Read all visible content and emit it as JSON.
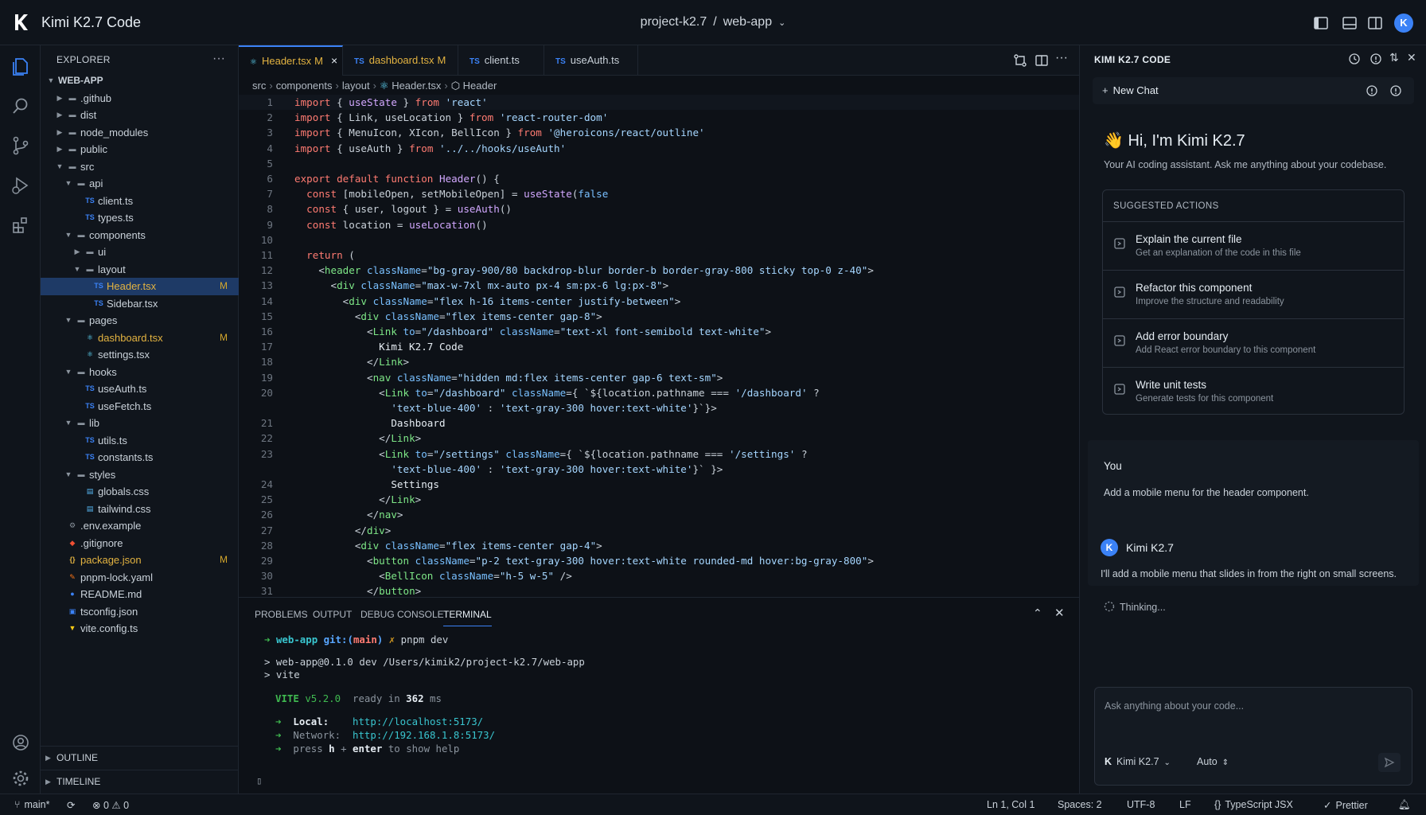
{
  "titlebar": {
    "app_title": "Kimi K2.7 Code",
    "project": "project-k2.7",
    "separator": "/",
    "folder": "web-app",
    "avatar_letter": "K"
  },
  "explorer": {
    "title": "EXPLORER",
    "more": "···",
    "tree": [
      {
        "label": "WEB-APP",
        "depth": 0,
        "type": "root"
      },
      {
        "label": ".github",
        "depth": 1,
        "type": "folder-closed"
      },
      {
        "label": "dist",
        "depth": 1,
        "type": "folder-closed"
      },
      {
        "label": "node_modules",
        "depth": 1,
        "type": "folder-closed"
      },
      {
        "label": "public",
        "depth": 1,
        "type": "folder-closed"
      },
      {
        "label": "src",
        "depth": 1,
        "type": "folder-open"
      },
      {
        "label": "api",
        "depth": 2,
        "type": "folder-open"
      },
      {
        "label": "client.ts",
        "depth": 3,
        "type": "ts"
      },
      {
        "label": "types.ts",
        "depth": 3,
        "type": "ts"
      },
      {
        "label": "components",
        "depth": 2,
        "type": "folder-open"
      },
      {
        "label": "ui",
        "depth": 3,
        "type": "folder-closed"
      },
      {
        "label": "layout",
        "depth": 3,
        "type": "folder-open"
      },
      {
        "label": "Header.tsx",
        "depth": 4,
        "type": "ts",
        "active": true,
        "badge": "M"
      },
      {
        "label": "Sidebar.tsx",
        "depth": 4,
        "type": "ts"
      },
      {
        "label": "pages",
        "depth": 2,
        "type": "folder-open"
      },
      {
        "label": "dashboard.tsx",
        "depth": 3,
        "type": "react",
        "badge": "M"
      },
      {
        "label": "settings.tsx",
        "depth": 3,
        "type": "react"
      },
      {
        "label": "hooks",
        "depth": 2,
        "type": "folder-open"
      },
      {
        "label": "useAuth.ts",
        "depth": 3,
        "type": "ts"
      },
      {
        "label": "useFetch.ts",
        "depth": 3,
        "type": "ts"
      },
      {
        "label": "lib",
        "depth": 2,
        "type": "folder-open"
      },
      {
        "label": "utils.ts",
        "depth": 3,
        "type": "ts"
      },
      {
        "label": "constants.ts",
        "depth": 3,
        "type": "ts"
      },
      {
        "label": "styles",
        "depth": 2,
        "type": "folder-open"
      },
      {
        "label": "globals.css",
        "depth": 3,
        "type": "css"
      },
      {
        "label": "tailwind.css",
        "depth": 3,
        "type": "css"
      },
      {
        "label": ".env.example",
        "depth": 1,
        "type": "env"
      },
      {
        "label": ".gitignore",
        "depth": 1,
        "type": "git"
      },
      {
        "label": "package.json",
        "depth": 1,
        "type": "json",
        "badge": "M"
      },
      {
        "label": "pnpm-lock.yaml",
        "depth": 1,
        "type": "yaml"
      },
      {
        "label": "README.md",
        "depth": 1,
        "type": "info"
      },
      {
        "label": "tsconfig.json",
        "depth": 1,
        "type": "ts-config"
      },
      {
        "label": "vite.config.ts",
        "depth": 1,
        "type": "vite"
      }
    ],
    "outline": "OUTLINE",
    "timeline": "TIMELINE"
  },
  "tabs": [
    {
      "label": "Header.tsx",
      "badge": "M",
      "active": true,
      "close": "×"
    },
    {
      "label": "dashboard.tsx",
      "badge": "M"
    },
    {
      "label": "client.ts"
    },
    {
      "label": "useAuth.ts"
    }
  ],
  "tab_type_label": "TS",
  "breadcrumb": [
    "src",
    "components",
    "layout",
    "Header.tsx",
    "Header"
  ],
  "code": [
    {
      "n": "1",
      "t": [
        [
          "kw",
          "import "
        ],
        [
          "",
          "{ "
        ],
        [
          "fn",
          "useState"
        ],
        [
          "",
          " } "
        ],
        [
          "kw",
          "from "
        ],
        [
          "str",
          "'react'"
        ]
      ]
    },
    {
      "n": "2",
      "t": [
        [
          "kw",
          "import "
        ],
        [
          "",
          "{ Link, useLocation } "
        ],
        [
          "kw",
          "from "
        ],
        [
          "str",
          "'react-router-dom'"
        ]
      ]
    },
    {
      "n": "3",
      "t": [
        [
          "kw",
          "import "
        ],
        [
          "",
          "{ MenuIcon, XIcon, BellIcon } "
        ],
        [
          "kw",
          "from "
        ],
        [
          "str",
          "'@heroicons/react/outline'"
        ]
      ]
    },
    {
      "n": "4",
      "t": [
        [
          "kw",
          "import "
        ],
        [
          "",
          "{ useAuth } "
        ],
        [
          "kw",
          "from "
        ],
        [
          "str",
          "'../../hooks/useAuth'"
        ]
      ]
    },
    {
      "n": "5",
      "t": []
    },
    {
      "n": "6",
      "t": [
        [
          "kw",
          "export default function "
        ],
        [
          "fn",
          "Header"
        ],
        [
          "",
          "() {"
        ]
      ]
    },
    {
      "n": "7",
      "t": [
        [
          "",
          "  "
        ],
        [
          "kw",
          "const "
        ],
        [
          "",
          "[mobileOpen, setMobileOpen] = "
        ],
        [
          "fn",
          "useState"
        ],
        [
          "",
          "("
        ],
        [
          "lit",
          "false"
        ],
        [
          ")"
        ]
      ]
    },
    {
      "n": "8",
      "t": [
        [
          "",
          "  "
        ],
        [
          "kw",
          "const "
        ],
        [
          "",
          "{ user, logout } = "
        ],
        [
          "fn",
          "useAuth"
        ],
        [
          "",
          "()"
        ]
      ]
    },
    {
      "n": "9",
      "t": [
        [
          "",
          "  "
        ],
        [
          "kw",
          "const "
        ],
        [
          "",
          "location = "
        ],
        [
          "fn",
          "useLocation"
        ],
        [
          "",
          "()"
        ]
      ]
    },
    {
      "n": "10",
      "t": []
    },
    {
      "n": "11",
      "t": [
        [
          "",
          "  "
        ],
        [
          "kw",
          "return "
        ],
        [
          "",
          "("
        ]
      ]
    },
    {
      "n": "12",
      "t": [
        [
          "",
          "    <"
        ],
        [
          "tag",
          "header "
        ],
        [
          "attr",
          "className"
        ],
        [
          "",
          "="
        ],
        [
          "str",
          "\"bg-gray-900/80 backdrop-blur border-b border-gray-800 sticky top-0 z-40\""
        ],
        [
          "",
          ">"
        ]
      ]
    },
    {
      "n": "13",
      "t": [
        [
          "",
          "      <"
        ],
        [
          "tag",
          "div "
        ],
        [
          "attr",
          "className"
        ],
        [
          "",
          "="
        ],
        [
          "str",
          "\"max-w-7xl mx-auto px-4 sm:px-6 lg:px-8\""
        ],
        [
          "",
          ">"
        ]
      ]
    },
    {
      "n": "14",
      "t": [
        [
          "",
          "        <"
        ],
        [
          "tag",
          "div "
        ],
        [
          "attr",
          "className"
        ],
        [
          "",
          "="
        ],
        [
          "str",
          "\"flex h-16 items-center justify-between\""
        ],
        [
          "",
          ">"
        ]
      ]
    },
    {
      "n": "15",
      "t": [
        [
          "",
          "          <"
        ],
        [
          "tag",
          "div "
        ],
        [
          "attr",
          "className"
        ],
        [
          "",
          "="
        ],
        [
          "str",
          "\"flex items-center gap-8\""
        ],
        [
          "",
          ">"
        ]
      ]
    },
    {
      "n": "16",
      "t": [
        [
          "",
          "            <"
        ],
        [
          "tag",
          "Link "
        ],
        [
          "attr",
          "to"
        ],
        [
          "",
          "="
        ],
        [
          "str",
          "\"/dashboard\" "
        ],
        [
          "attr",
          "className"
        ],
        [
          "",
          "="
        ],
        [
          "str",
          "\"text-xl font-semibold text-white\""
        ],
        [
          "",
          ">"
        ]
      ]
    },
    {
      "n": "17",
      "t": [
        [
          "jsx",
          "              Kimi K2.7 Code"
        ]
      ]
    },
    {
      "n": "18",
      "t": [
        [
          "",
          "            </"
        ],
        [
          "tag",
          "Link"
        ],
        [
          "",
          ">"
        ]
      ]
    },
    {
      "n": "19",
      "t": [
        [
          "",
          "            <"
        ],
        [
          "tag",
          "nav "
        ],
        [
          "attr",
          "className"
        ],
        [
          "",
          "="
        ],
        [
          "str",
          "\"hidden md:flex items-center gap-6 text-sm\""
        ],
        [
          "",
          ">"
        ]
      ]
    },
    {
      "n": "20",
      "t": [
        [
          "",
          "              <"
        ],
        [
          "tag",
          "Link "
        ],
        [
          "attr",
          "to"
        ],
        [
          "",
          "="
        ],
        [
          "str",
          "\"/dashboard\" "
        ],
        [
          "attr",
          "className"
        ],
        [
          "",
          "={ `${location.pathname === "
        ],
        [
          "str",
          "'/dashboard'"
        ],
        [
          "",
          " ?"
        ]
      ]
    },
    {
      "n": "",
      "t": [
        [
          "",
          "                "
        ],
        [
          "str",
          "'text-blue-400'"
        ],
        [
          "",
          " : "
        ],
        [
          "str",
          "'text-gray-300 hover:text-white'"
        ],
        [
          "",
          "}`}>"
        ]
      ]
    },
    {
      "n": "21",
      "t": [
        [
          "jsx",
          "                Dashboard"
        ]
      ]
    },
    {
      "n": "22",
      "t": [
        [
          "",
          "              </"
        ],
        [
          "tag",
          "Link"
        ],
        [
          "",
          ">"
        ]
      ]
    },
    {
      "n": "23",
      "t": [
        [
          "",
          "              <"
        ],
        [
          "tag",
          "Link "
        ],
        [
          "attr",
          "to"
        ],
        [
          "",
          "="
        ],
        [
          "str",
          "\"/settings\" "
        ],
        [
          "attr",
          "className"
        ],
        [
          "",
          "={ `${location.pathname === "
        ],
        [
          "str",
          "'/settings'"
        ],
        [
          "",
          " ?"
        ]
      ]
    },
    {
      "n": "",
      "t": [
        [
          "",
          "                "
        ],
        [
          "str",
          "'text-blue-400'"
        ],
        [
          "",
          " : "
        ],
        [
          "str",
          "'text-gray-300 hover:text-white'"
        ],
        [
          "",
          "}` }>"
        ]
      ]
    },
    {
      "n": "24",
      "t": [
        [
          "jsx",
          "                Settings"
        ]
      ]
    },
    {
      "n": "25",
      "t": [
        [
          "",
          "              </"
        ],
        [
          "tag",
          "Link"
        ],
        [
          "",
          ">"
        ]
      ]
    },
    {
      "n": "26",
      "t": [
        [
          "",
          "            </"
        ],
        [
          "tag",
          "nav"
        ],
        [
          "",
          ">"
        ]
      ]
    },
    {
      "n": "27",
      "t": [
        [
          "",
          "          </"
        ],
        [
          "tag",
          "div"
        ],
        [
          "",
          ">"
        ]
      ]
    },
    {
      "n": "28",
      "t": [
        [
          "",
          "          <"
        ],
        [
          "tag",
          "div "
        ],
        [
          "attr",
          "className"
        ],
        [
          "",
          "="
        ],
        [
          "str",
          "\"flex items-center gap-4\""
        ],
        [
          "",
          ">"
        ]
      ]
    },
    {
      "n": "29",
      "t": [
        [
          "",
          "            <"
        ],
        [
          "tag",
          "button "
        ],
        [
          "attr",
          "className"
        ],
        [
          "",
          "="
        ],
        [
          "str",
          "\"p-2 text-gray-300 hover:text-white rounded-md hover:bg-gray-800\""
        ],
        [
          "",
          ">"
        ]
      ]
    },
    {
      "n": "30",
      "t": [
        [
          "",
          "              <"
        ],
        [
          "tag",
          "BellIcon "
        ],
        [
          "attr",
          "className"
        ],
        [
          "",
          "="
        ],
        [
          "str",
          "\"h-5 w-5\""
        ],
        [
          "",
          " />"
        ]
      ]
    },
    {
      "n": "31",
      "t": [
        [
          "",
          "            </"
        ],
        [
          "tag",
          "button"
        ],
        [
          "",
          ">"
        ]
      ]
    }
  ],
  "panel": {
    "tabs": [
      "PROBLEMS",
      "OUTPUT",
      "DEBUG CONSOLE",
      "TERMINAL"
    ],
    "active_tab": "TERMINAL",
    "prompt_arrow": "➜",
    "prompt_dir": "web-app",
    "prompt_git": "git:(",
    "prompt_branch": "main",
    "prompt_git_close": ")",
    "prompt_x": "✗",
    "prompt_cmd": "pnpm dev",
    "out1": "> web-app@0.1.0 dev /Users/kimik2/project-k2.7/web-app",
    "out2": "> vite",
    "vite_name": "VITE",
    "vite_version": "v5.2.0",
    "ready_text": "ready in",
    "ready_ms": "362",
    "ms_unit": "ms",
    "local_label": "Local:",
    "local_url": "http://localhost:5173/",
    "network_label": "Network:",
    "network_url": "http://192.168.1.8:5173/",
    "help_press": "press",
    "help_key1": "h",
    "help_plus": "+",
    "help_key2": "enter",
    "help_rest": "to show help",
    "cursor": "▯"
  },
  "chat": {
    "title": "KIMI K2.7 CODE",
    "new_chat": "New Chat",
    "greeting": "👋 Hi, I'm Kimi K2.7",
    "greeting_sub": "Your AI coding assistant. Ask me anything about your codebase.",
    "suggested_title": "SUGGESTED ACTIONS",
    "suggestions": [
      {
        "title": "Explain the current file",
        "desc": "Get an explanation of the code in this file"
      },
      {
        "title": "Refactor this component",
        "desc": "Improve the structure and readability"
      },
      {
        "title": "Add error boundary",
        "desc": "Add React error boundary to this component"
      },
      {
        "title": "Write unit tests",
        "desc": "Generate tests for this component"
      }
    ],
    "you_label": "You",
    "you_message": "Add a mobile menu for the header component.",
    "assistant_avatar": "K",
    "assistant_name": "Kimi K2.7",
    "assistant_message": "I'll add a mobile menu that slides in from the right on small screens.",
    "thinking": "Thinking...",
    "input_placeholder": "Ask anything about your code...",
    "model": "Kimi K2.7",
    "mode": "Auto"
  },
  "statusbar": {
    "branch": "main*",
    "errors": "0",
    "warnings": "0",
    "position": "Ln 1, Col 1",
    "spaces": "Spaces: 2",
    "encoding": "UTF-8",
    "eol": "LF",
    "language": "TypeScript JSX",
    "formatter": "Prettier"
  },
  "colors": {
    "accent": "#3b82f6",
    "modified": "#e3b341",
    "background": "#0d1117"
  }
}
